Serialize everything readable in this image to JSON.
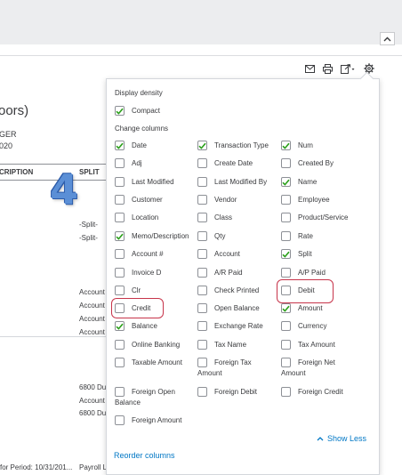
{
  "report": {
    "title_partial": "oors)",
    "sub1": "GER",
    "sub2": "020",
    "columns": [
      "CRIPTION",
      "SPLIT"
    ],
    "split_values": [
      "-Split-",
      "-Split-"
    ],
    "account_values": [
      "Account",
      "Account",
      "Account",
      "Account"
    ],
    "lower_values": [
      "6800 Du",
      "Account",
      "6800 Du"
    ],
    "footer_left": "for Period: 10/31/201...",
    "footer_right": "Payroll L"
  },
  "toolbar": {
    "icons": [
      "email-icon",
      "print-icon",
      "export-icon",
      "gear-icon"
    ]
  },
  "panel": {
    "density_title": "Display density",
    "compact": {
      "label": "Compact",
      "checked": true
    },
    "columns_title": "Change columns",
    "options": [
      {
        "label": "Date",
        "checked": true
      },
      {
        "label": "Transaction Type",
        "checked": true
      },
      {
        "label": "Num",
        "checked": true
      },
      {
        "label": "Adj",
        "checked": false
      },
      {
        "label": "Create Date",
        "checked": false
      },
      {
        "label": "Created By",
        "checked": false
      },
      {
        "label": "Last Modified",
        "checked": false
      },
      {
        "label": "Last Modified By",
        "checked": false
      },
      {
        "label": "Name",
        "checked": true
      },
      {
        "label": "Customer",
        "checked": false
      },
      {
        "label": "Vendor",
        "checked": false
      },
      {
        "label": "Employee",
        "checked": false
      },
      {
        "label": "Location",
        "checked": false
      },
      {
        "label": "Class",
        "checked": false
      },
      {
        "label": "Product/Service",
        "checked": false
      },
      {
        "label": "Memo/Description",
        "checked": true
      },
      {
        "label": "Qty",
        "checked": false
      },
      {
        "label": "Rate",
        "checked": false
      },
      {
        "label": "Account #",
        "checked": false
      },
      {
        "label": "Account",
        "checked": false
      },
      {
        "label": "Split",
        "checked": true
      },
      {
        "label": "Invoice D",
        "checked": false
      },
      {
        "label": "A/R Paid",
        "checked": false
      },
      {
        "label": "A/P Paid",
        "checked": false
      },
      {
        "label": "Clr",
        "checked": false
      },
      {
        "label": "Check Printed",
        "checked": false
      },
      {
        "label": "Debit",
        "checked": false
      },
      {
        "label": "Credit",
        "checked": false
      },
      {
        "label": "Open Balance",
        "checked": false
      },
      {
        "label": "Amount",
        "checked": true
      },
      {
        "label": "Balance",
        "checked": true
      },
      {
        "label": "Exchange Rate",
        "checked": false
      },
      {
        "label": "Currency",
        "checked": false
      },
      {
        "label": "Online Banking",
        "checked": false
      },
      {
        "label": "Tax Name",
        "checked": false
      },
      {
        "label": "Tax Amount",
        "checked": false
      },
      {
        "label": "Taxable Amount",
        "checked": false
      },
      {
        "label": "Foreign Tax",
        "label2": "Amount",
        "checked": false
      },
      {
        "label": "Foreign Net",
        "label2": "Amount",
        "checked": false
      },
      {
        "label": "Foreign Open",
        "label2": "Balance",
        "checked": false
      },
      {
        "label": "Foreign Debit",
        "checked": false
      },
      {
        "label": "Foreign Credit",
        "checked": false
      },
      {
        "label": "Foreign Amount",
        "checked": false
      }
    ],
    "show_less": "Show Less",
    "reorder": "Reorder columns"
  },
  "annotation": {
    "step_number": "4"
  },
  "colors": {
    "accent": "#0077c5",
    "check": "#2ca01c",
    "highlight": "#c7344a"
  }
}
